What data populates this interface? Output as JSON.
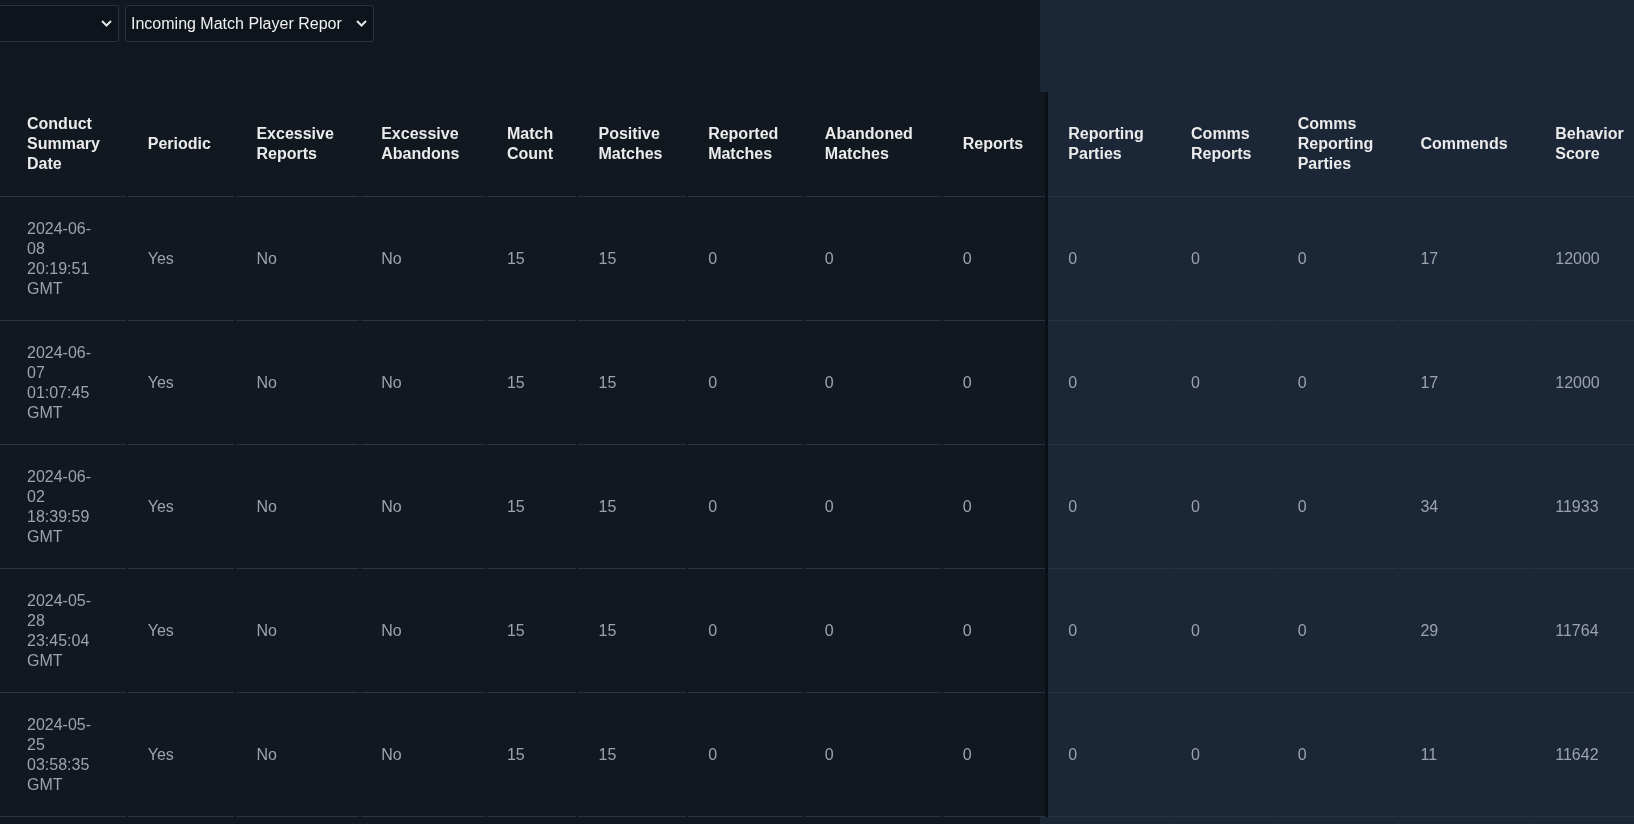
{
  "dropdowns": [
    {
      "kind": "empty"
    },
    {
      "kind": "text",
      "value": "Incoming Match Player Repor"
    }
  ],
  "table": {
    "columns": [
      {
        "label": "Conduct Summary Date",
        "shaded": false
      },
      {
        "label": "Periodic",
        "shaded": false
      },
      {
        "label": "Excessive Reports",
        "shaded": false
      },
      {
        "label": "Excessive Abandons",
        "shaded": false
      },
      {
        "label": "Match Count",
        "shaded": false
      },
      {
        "label": "Positive Matches",
        "shaded": false
      },
      {
        "label": "Reported Matches",
        "shaded": false
      },
      {
        "label": "Abandoned Matches",
        "shaded": false
      },
      {
        "label": "Reports",
        "shaded": false
      },
      {
        "label": "Reporting Parties",
        "shaded": true
      },
      {
        "label": "Comms Reports",
        "shaded": true
      },
      {
        "label": "Comms Reporting Parties",
        "shaded": true
      },
      {
        "label": "Commends",
        "shaded": true
      },
      {
        "label": "Behavior Score",
        "shaded": true
      }
    ],
    "rows": [
      [
        "2024-06-08 20:19:51 GMT",
        "Yes",
        "No",
        "No",
        "15",
        "15",
        "0",
        "0",
        "0",
        "0",
        "0",
        "0",
        "17",
        "12000"
      ],
      [
        "2024-06-07 01:07:45 GMT",
        "Yes",
        "No",
        "No",
        "15",
        "15",
        "0",
        "0",
        "0",
        "0",
        "0",
        "0",
        "17",
        "12000"
      ],
      [
        "2024-06-02 18:39:59 GMT",
        "Yes",
        "No",
        "No",
        "15",
        "15",
        "0",
        "0",
        "0",
        "0",
        "0",
        "0",
        "34",
        "11933"
      ],
      [
        "2024-05-28 23:45:04 GMT",
        "Yes",
        "No",
        "No",
        "15",
        "15",
        "0",
        "0",
        "0",
        "0",
        "0",
        "0",
        "29",
        "11764"
      ],
      [
        "2024-05-25 03:58:35 GMT",
        "Yes",
        "No",
        "No",
        "15",
        "15",
        "0",
        "0",
        "0",
        "0",
        "0",
        "0",
        "11",
        "11642"
      ]
    ]
  }
}
